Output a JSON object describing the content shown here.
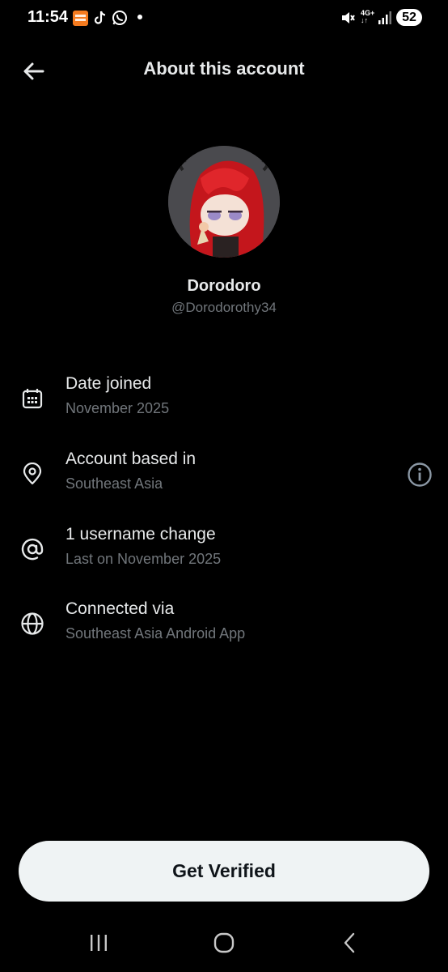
{
  "status_bar": {
    "time": "11:54",
    "network": "4G+",
    "battery": "52",
    "notification_icons": [
      "temu-icon",
      "tiktok-icon",
      "whatsapp-icon",
      "dot-icon"
    ]
  },
  "header": {
    "title": "About this account"
  },
  "profile": {
    "name": "Dorodoro",
    "handle": "@Dorodorothy34"
  },
  "info_rows": [
    {
      "icon": "calendar-icon",
      "title": "Date joined",
      "subtitle": "November 2025"
    },
    {
      "icon": "location-pin-icon",
      "title": "Account based in",
      "subtitle": "Southeast Asia",
      "trailing_icon": "info-icon"
    },
    {
      "icon": "at-sign-icon",
      "title": "1 username change",
      "subtitle": "Last on November 2025"
    },
    {
      "icon": "globe-icon",
      "title": "Connected via",
      "subtitle": "Southeast Asia Android App"
    }
  ],
  "verify_button": {
    "label": "Get Verified"
  },
  "colors": {
    "background": "#000000",
    "primary_text": "#e7e9ea",
    "secondary_text": "#71767b",
    "button_bg": "#eff3f4"
  }
}
